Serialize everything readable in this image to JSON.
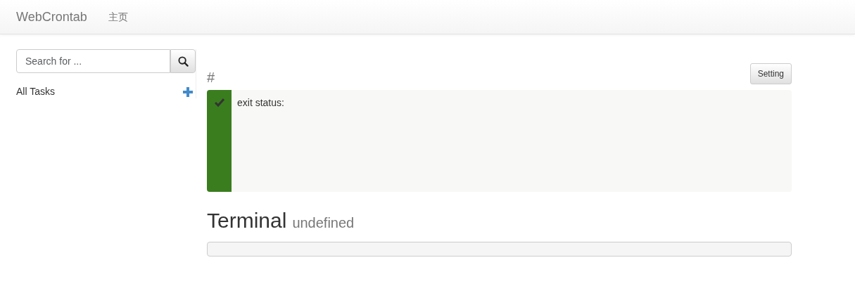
{
  "navbar": {
    "brand": "WebCrontab",
    "links": [
      "主页"
    ]
  },
  "sidebar": {
    "search": {
      "placeholder": "Search for ..."
    },
    "all_tasks": "All Tasks"
  },
  "task": {
    "title": "#",
    "setting_button": "Setting",
    "result": {
      "ok": true,
      "text": "exit status:"
    }
  },
  "terminal": {
    "title": "Terminal",
    "subtitle": "undefined"
  }
}
